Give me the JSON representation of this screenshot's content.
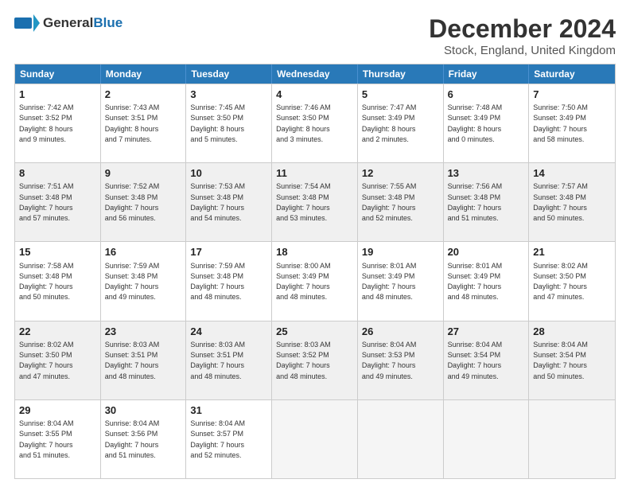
{
  "header": {
    "logo_general": "General",
    "logo_blue": "Blue",
    "main_title": "December 2024",
    "subtitle": "Stock, England, United Kingdom"
  },
  "weekdays": [
    "Sunday",
    "Monday",
    "Tuesday",
    "Wednesday",
    "Thursday",
    "Friday",
    "Saturday"
  ],
  "rows": [
    [
      {
        "day": "1",
        "lines": [
          "Sunrise: 7:42 AM",
          "Sunset: 3:52 PM",
          "Daylight: 8 hours",
          "and 9 minutes."
        ]
      },
      {
        "day": "2",
        "lines": [
          "Sunrise: 7:43 AM",
          "Sunset: 3:51 PM",
          "Daylight: 8 hours",
          "and 7 minutes."
        ]
      },
      {
        "day": "3",
        "lines": [
          "Sunrise: 7:45 AM",
          "Sunset: 3:50 PM",
          "Daylight: 8 hours",
          "and 5 minutes."
        ]
      },
      {
        "day": "4",
        "lines": [
          "Sunrise: 7:46 AM",
          "Sunset: 3:50 PM",
          "Daylight: 8 hours",
          "and 3 minutes."
        ]
      },
      {
        "day": "5",
        "lines": [
          "Sunrise: 7:47 AM",
          "Sunset: 3:49 PM",
          "Daylight: 8 hours",
          "and 2 minutes."
        ]
      },
      {
        "day": "6",
        "lines": [
          "Sunrise: 7:48 AM",
          "Sunset: 3:49 PM",
          "Daylight: 8 hours",
          "and 0 minutes."
        ]
      },
      {
        "day": "7",
        "lines": [
          "Sunrise: 7:50 AM",
          "Sunset: 3:49 PM",
          "Daylight: 7 hours",
          "and 58 minutes."
        ]
      }
    ],
    [
      {
        "day": "8",
        "lines": [
          "Sunrise: 7:51 AM",
          "Sunset: 3:48 PM",
          "Daylight: 7 hours",
          "and 57 minutes."
        ]
      },
      {
        "day": "9",
        "lines": [
          "Sunrise: 7:52 AM",
          "Sunset: 3:48 PM",
          "Daylight: 7 hours",
          "and 56 minutes."
        ]
      },
      {
        "day": "10",
        "lines": [
          "Sunrise: 7:53 AM",
          "Sunset: 3:48 PM",
          "Daylight: 7 hours",
          "and 54 minutes."
        ]
      },
      {
        "day": "11",
        "lines": [
          "Sunrise: 7:54 AM",
          "Sunset: 3:48 PM",
          "Daylight: 7 hours",
          "and 53 minutes."
        ]
      },
      {
        "day": "12",
        "lines": [
          "Sunrise: 7:55 AM",
          "Sunset: 3:48 PM",
          "Daylight: 7 hours",
          "and 52 minutes."
        ]
      },
      {
        "day": "13",
        "lines": [
          "Sunrise: 7:56 AM",
          "Sunset: 3:48 PM",
          "Daylight: 7 hours",
          "and 51 minutes."
        ]
      },
      {
        "day": "14",
        "lines": [
          "Sunrise: 7:57 AM",
          "Sunset: 3:48 PM",
          "Daylight: 7 hours",
          "and 50 minutes."
        ]
      }
    ],
    [
      {
        "day": "15",
        "lines": [
          "Sunrise: 7:58 AM",
          "Sunset: 3:48 PM",
          "Daylight: 7 hours",
          "and 50 minutes."
        ]
      },
      {
        "day": "16",
        "lines": [
          "Sunrise: 7:59 AM",
          "Sunset: 3:48 PM",
          "Daylight: 7 hours",
          "and 49 minutes."
        ]
      },
      {
        "day": "17",
        "lines": [
          "Sunrise: 7:59 AM",
          "Sunset: 3:48 PM",
          "Daylight: 7 hours",
          "and 48 minutes."
        ]
      },
      {
        "day": "18",
        "lines": [
          "Sunrise: 8:00 AM",
          "Sunset: 3:49 PM",
          "Daylight: 7 hours",
          "and 48 minutes."
        ]
      },
      {
        "day": "19",
        "lines": [
          "Sunrise: 8:01 AM",
          "Sunset: 3:49 PM",
          "Daylight: 7 hours",
          "and 48 minutes."
        ]
      },
      {
        "day": "20",
        "lines": [
          "Sunrise: 8:01 AM",
          "Sunset: 3:49 PM",
          "Daylight: 7 hours",
          "and 48 minutes."
        ]
      },
      {
        "day": "21",
        "lines": [
          "Sunrise: 8:02 AM",
          "Sunset: 3:50 PM",
          "Daylight: 7 hours",
          "and 47 minutes."
        ]
      }
    ],
    [
      {
        "day": "22",
        "lines": [
          "Sunrise: 8:02 AM",
          "Sunset: 3:50 PM",
          "Daylight: 7 hours",
          "and 47 minutes."
        ]
      },
      {
        "day": "23",
        "lines": [
          "Sunrise: 8:03 AM",
          "Sunset: 3:51 PM",
          "Daylight: 7 hours",
          "and 48 minutes."
        ]
      },
      {
        "day": "24",
        "lines": [
          "Sunrise: 8:03 AM",
          "Sunset: 3:51 PM",
          "Daylight: 7 hours",
          "and 48 minutes."
        ]
      },
      {
        "day": "25",
        "lines": [
          "Sunrise: 8:03 AM",
          "Sunset: 3:52 PM",
          "Daylight: 7 hours",
          "and 48 minutes."
        ]
      },
      {
        "day": "26",
        "lines": [
          "Sunrise: 8:04 AM",
          "Sunset: 3:53 PM",
          "Daylight: 7 hours",
          "and 49 minutes."
        ]
      },
      {
        "day": "27",
        "lines": [
          "Sunrise: 8:04 AM",
          "Sunset: 3:54 PM",
          "Daylight: 7 hours",
          "and 49 minutes."
        ]
      },
      {
        "day": "28",
        "lines": [
          "Sunrise: 8:04 AM",
          "Sunset: 3:54 PM",
          "Daylight: 7 hours",
          "and 50 minutes."
        ]
      }
    ],
    [
      {
        "day": "29",
        "lines": [
          "Sunrise: 8:04 AM",
          "Sunset: 3:55 PM",
          "Daylight: 7 hours",
          "and 51 minutes."
        ]
      },
      {
        "day": "30",
        "lines": [
          "Sunrise: 8:04 AM",
          "Sunset: 3:56 PM",
          "Daylight: 7 hours",
          "and 51 minutes."
        ]
      },
      {
        "day": "31",
        "lines": [
          "Sunrise: 8:04 AM",
          "Sunset: 3:57 PM",
          "Daylight: 7 hours",
          "and 52 minutes."
        ]
      },
      {
        "day": "",
        "lines": []
      },
      {
        "day": "",
        "lines": []
      },
      {
        "day": "",
        "lines": []
      },
      {
        "day": "",
        "lines": []
      }
    ]
  ]
}
